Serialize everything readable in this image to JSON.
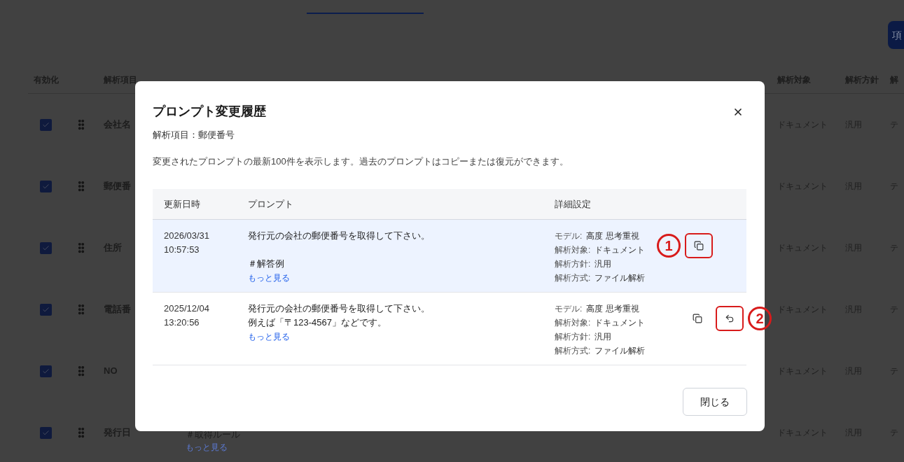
{
  "page": {
    "action_button": "項",
    "table": {
      "columns": [
        "有効化",
        "解析項目",
        "解析対象",
        "解析方針",
        "解"
      ],
      "rows": [
        {
          "checked": true,
          "name": "会社名",
          "target": "ドキュメント",
          "policy": "汎用",
          "method": "テ"
        },
        {
          "checked": true,
          "name": "郵便番",
          "target": "ドキュメント",
          "policy": "汎用",
          "method": "テ"
        },
        {
          "checked": true,
          "name": "住所",
          "target": "ドキュメント",
          "policy": "汎用",
          "method": "テ"
        },
        {
          "checked": true,
          "name": "電話番",
          "target": "ドキュメント",
          "policy": "汎用",
          "method": "テ"
        },
        {
          "checked": true,
          "name": "NO",
          "target": "ドキュメント",
          "policy": "汎用",
          "method": "テ"
        },
        {
          "checked": true,
          "name": "発行日",
          "prompt_lines": [
            "＃取得ルール"
          ],
          "more_link": "もっと見る",
          "target": "ドキュメント",
          "policy": "汎用",
          "method": "テ"
        }
      ]
    }
  },
  "dialog": {
    "title": "プロンプト変更履歴",
    "subtitle": "解析項目：郵便番号",
    "description": "変更されたプロンプトの最新100件を表示します。過去のプロンプトはコピーまたは復元ができます。",
    "columns": [
      "更新日時",
      "プロンプト",
      "詳細設定"
    ],
    "rows": [
      {
        "selected": true,
        "date": "2026/03/31",
        "time": "10:57:53",
        "prompt_paragraphs": [
          [
            "発行元の会社の郵便番号を取得して下さい。"
          ],
          [
            "＃解答例"
          ]
        ],
        "more_link": "もっと見る",
        "details": [
          {
            "label": "モデル:",
            "value": "高度 思考重視"
          },
          {
            "label": "解析対象:",
            "value": "ドキュメント"
          },
          {
            "label": "解析方針:",
            "value": "汎用"
          },
          {
            "label": "解析方式:",
            "value": "ファイル解析"
          }
        ],
        "actions": [
          {
            "kind": "callout",
            "text": "1"
          },
          {
            "kind": "copy",
            "highlighted": true
          }
        ]
      },
      {
        "selected": false,
        "date": "2025/12/04",
        "time": "13:20:56",
        "prompt_paragraphs": [
          [
            "発行元の会社の郵便番号を取得して下さい。",
            "例えば「〒123-4567」などです。"
          ]
        ],
        "more_link": "もっと見る",
        "details": [
          {
            "label": "モデル:",
            "value": "高度 思考重視"
          },
          {
            "label": "解析対象:",
            "value": "ドキュメント"
          },
          {
            "label": "解析方針:",
            "value": "汎用"
          },
          {
            "label": "解析方式:",
            "value": "ファイル解析"
          }
        ],
        "actions": [
          {
            "kind": "copy",
            "highlighted": false
          },
          {
            "kind": "restore",
            "highlighted": true
          },
          {
            "kind": "callout",
            "text": "2"
          }
        ]
      }
    ],
    "close_button": "閉じる"
  }
}
